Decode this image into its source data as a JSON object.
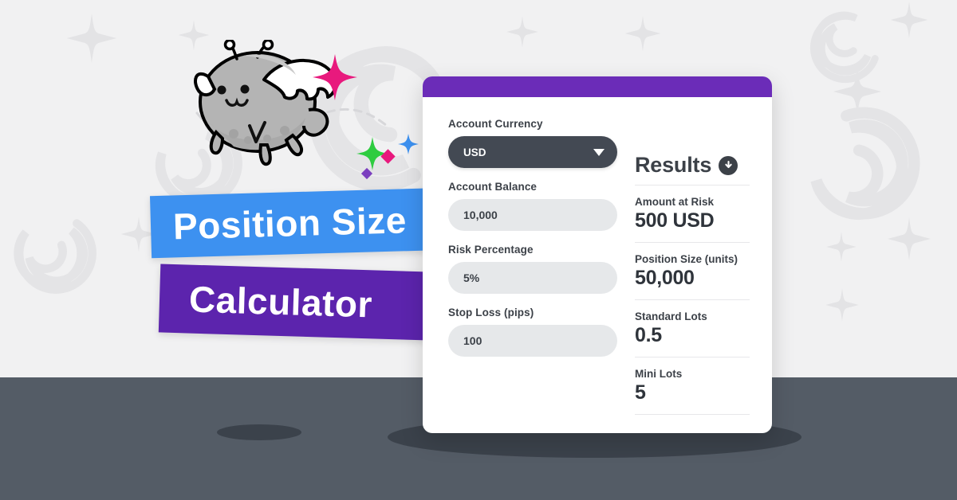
{
  "page": {
    "title_banner_line1": "Position Size",
    "title_banner_line2": "Calculator",
    "colors": {
      "background": "#f1f1f2",
      "floor": "#545c66",
      "banner_blue": "#3d91f0",
      "banner_purple": "#5c24ad",
      "card_topbar_purple": "#6b2cb8",
      "select_dark": "#434953",
      "input_grey": "#e6e8ea",
      "text_dark": "#3c4148"
    }
  },
  "card": {
    "form": {
      "fields": [
        {
          "label": "Account Currency",
          "type": "select",
          "value": "USD",
          "icon": "chevron-down-icon"
        },
        {
          "label": "Account Balance",
          "type": "text",
          "value": "10,000",
          "placeholder": "10,000"
        },
        {
          "label": "Risk Percentage",
          "type": "text",
          "value": "5%",
          "placeholder": "5%"
        },
        {
          "label": "Stop Loss (pips)",
          "type": "text",
          "value": "100",
          "placeholder": "100"
        }
      ]
    },
    "results": {
      "title": "Results",
      "download_icon": "download-arrow-icon",
      "items": [
        {
          "label": "Amount at Risk",
          "value": "500 USD"
        },
        {
          "label": "Position Size (units)",
          "value": "50,000"
        },
        {
          "label": "Standard Lots",
          "value": "0.5"
        },
        {
          "label": "Mini Lots",
          "value": "5"
        }
      ]
    }
  },
  "decor": {
    "mascot": "winged-cat-mascot",
    "sparkle_colors": [
      "#e8197d",
      "#3d91f0",
      "#2ecc40",
      "#7b3fbf"
    ],
    "background_shapes": [
      "four-point-star",
      "spiral-swirl"
    ]
  }
}
